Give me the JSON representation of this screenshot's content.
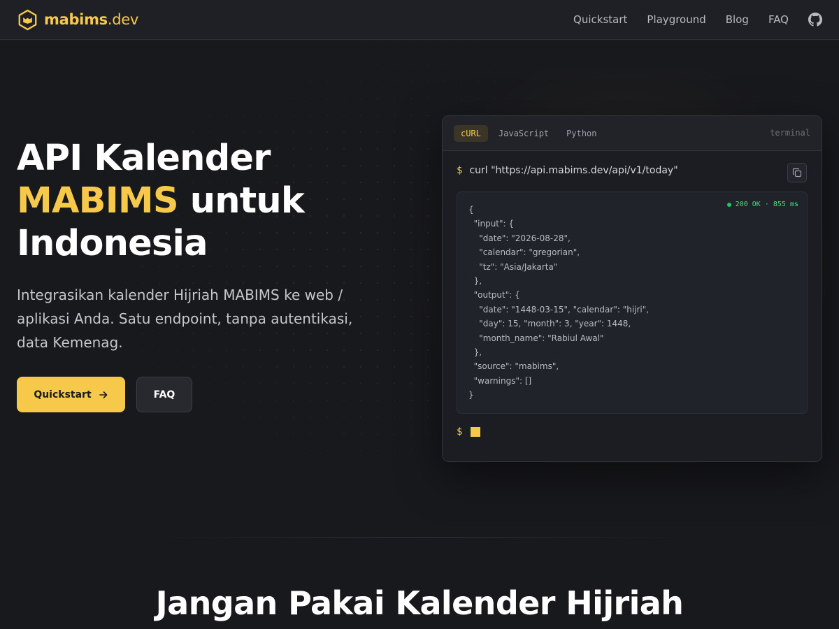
{
  "brand": {
    "name": "mabims",
    "tld": ".dev"
  },
  "nav": {
    "items": [
      {
        "label": "Quickstart"
      },
      {
        "label": "Playground"
      },
      {
        "label": "Blog"
      },
      {
        "label": "FAQ"
      }
    ],
    "github_icon": "github-icon"
  },
  "hero": {
    "title_line1": "API Kalender",
    "title_accent": "MABIMS",
    "title_line2_rest": " untuk",
    "title_line3": "Indonesia",
    "subtitle": "Integrasikan kalender Hijriah MABIMS ke web / aplikasi Anda. Satu endpoint, tanpa autentikasi, data Kemenag.",
    "primary_cta": "Quickstart",
    "secondary_cta": "FAQ"
  },
  "terminal": {
    "tabs": [
      {
        "label": "cURL",
        "active": true
      },
      {
        "label": "JavaScript",
        "active": false
      },
      {
        "label": "Python",
        "active": false
      }
    ],
    "label": "terminal",
    "prompt": "$",
    "command": "curl \"https://api.mabims.dev/api/v1/today\"",
    "status": "200 OK · 855 ms",
    "response_lines": [
      "{",
      "  \"input\": {",
      "    \"date\": \"2026-08-28\",",
      "    \"calendar\": \"gregorian\",",
      "    \"tz\": \"Asia/Jakarta\"",
      "  },",
      "  \"output\": {",
      "    \"date\": \"1448-03-15\", \"calendar\": \"hijri\",",
      "    \"day\": 15, \"month\": 3, \"year\": 1448,",
      "    \"month_name\": \"Rabiul Awal\"",
      "  },",
      "  \"source\": \"mabims\",",
      "  \"warnings\": []",
      "}"
    ]
  },
  "section": {
    "title": "Jangan Pakai Kalender Hijriah"
  },
  "colors": {
    "accent": "#f7c94b",
    "background": "#18191d",
    "status_ok": "#22c55e"
  }
}
